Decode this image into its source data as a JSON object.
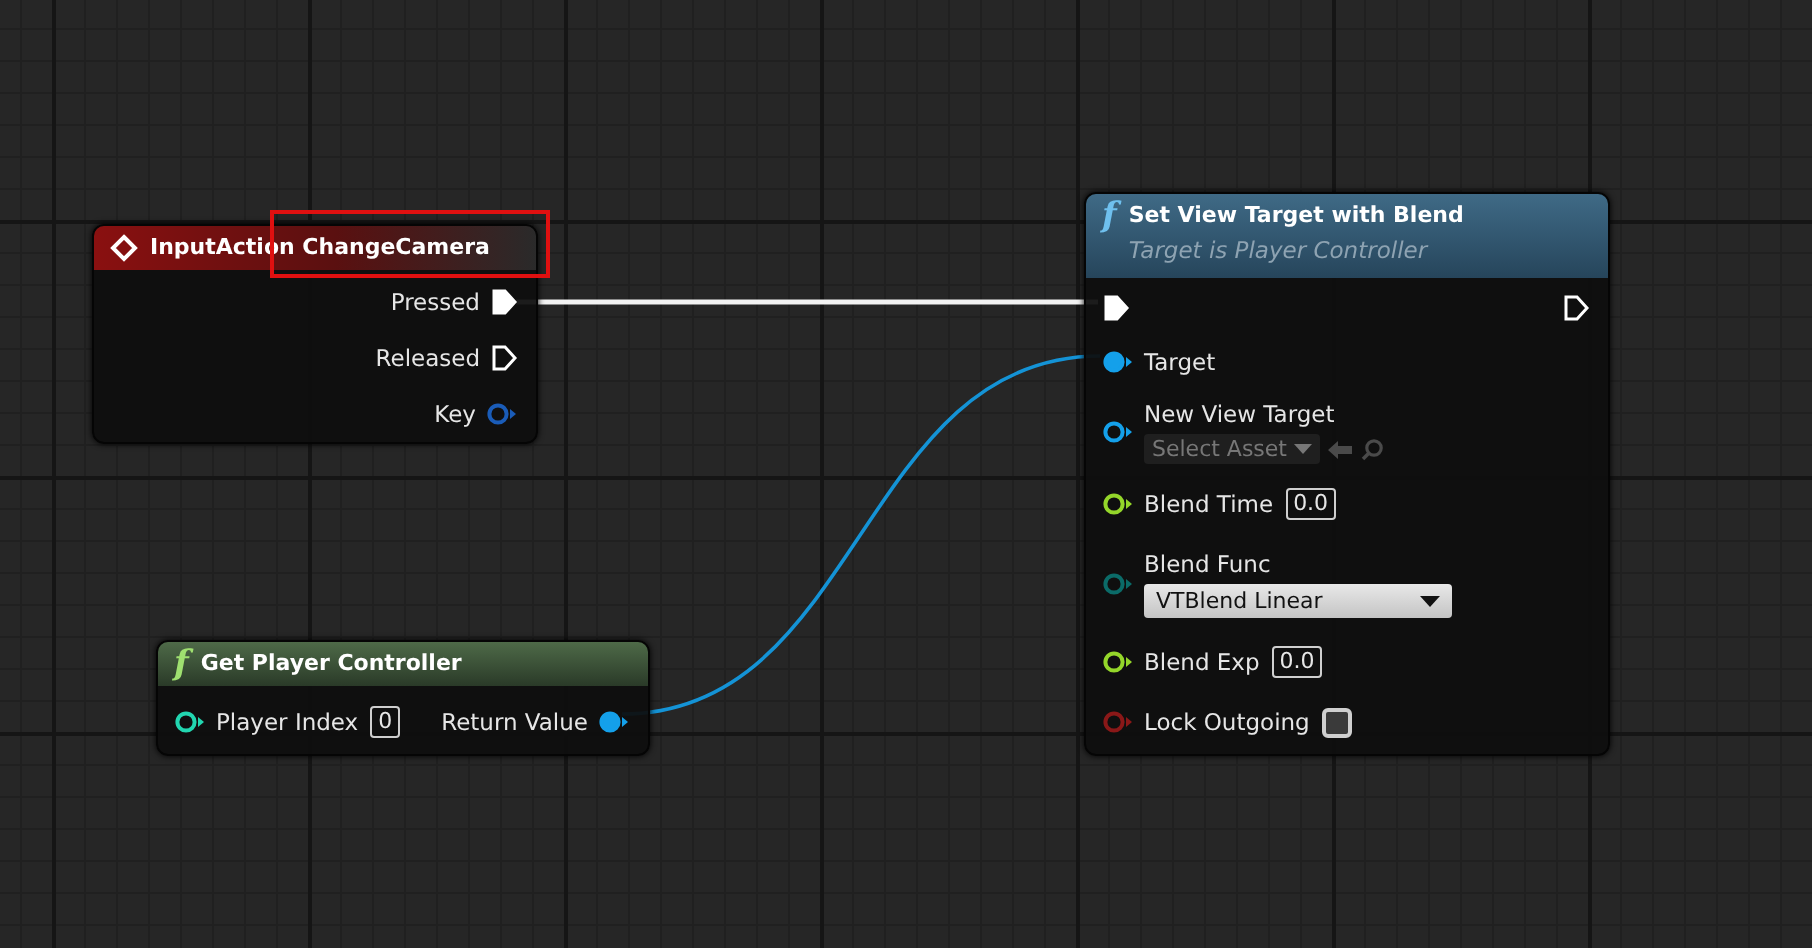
{
  "nodes": [
    {
      "kind": "event",
      "title": "InputAction ChangeCamera",
      "highlighted": true,
      "rows": [
        {
          "kind": "exec_out",
          "label": "Pressed",
          "connected": true
        },
        {
          "kind": "exec_out",
          "label": "Released",
          "connected": false
        },
        {
          "kind": "data_out",
          "label": "Key",
          "color": "#1a5cb8",
          "connected": false
        }
      ]
    },
    {
      "kind": "pure_function",
      "icon_glyph": "f",
      "title": "Get Player Controller",
      "rows": [
        {
          "kind": "data_in_out",
          "label": "Player Index",
          "color": "#22d6b0",
          "connected": false,
          "widget": {
            "kind": "number",
            "value": "0"
          },
          "output": {
            "label": "Return Value",
            "color": "#14a0ea",
            "connected": true
          }
        }
      ]
    },
    {
      "kind": "function",
      "icon_glyph": "f",
      "title": "Set View Target with Blend",
      "subtitle": "Target is Player Controller",
      "rows": [
        {
          "kind": "exec_pair",
          "connected_in": true,
          "connected_out": false
        },
        {
          "kind": "data_in",
          "label": "Target",
          "color": "#14a0ea",
          "connected": true
        },
        {
          "kind": "data_in",
          "label": "New View Target",
          "color": "#14a0ea",
          "connected": false,
          "widget": {
            "kind": "asset",
            "label": "Select Asset"
          }
        },
        {
          "kind": "data_in",
          "label": "Blend Time",
          "color": "#94d62a",
          "connected": false,
          "widget": {
            "kind": "number",
            "value": "0.0"
          }
        },
        {
          "kind": "data_in",
          "label": "Blend Func",
          "color": "#0b6b68",
          "connected": false,
          "widget": {
            "kind": "dropdown",
            "value": "VTBlend Linear"
          }
        },
        {
          "kind": "data_in",
          "label": "Blend Exp",
          "color": "#94d62a",
          "connected": false,
          "widget": {
            "kind": "number",
            "value": "0.0"
          }
        },
        {
          "kind": "data_in",
          "label": "Lock Outgoing",
          "color": "#8a1818",
          "connected": false,
          "widget": {
            "kind": "checkbox",
            "checked": false
          }
        }
      ]
    }
  ]
}
